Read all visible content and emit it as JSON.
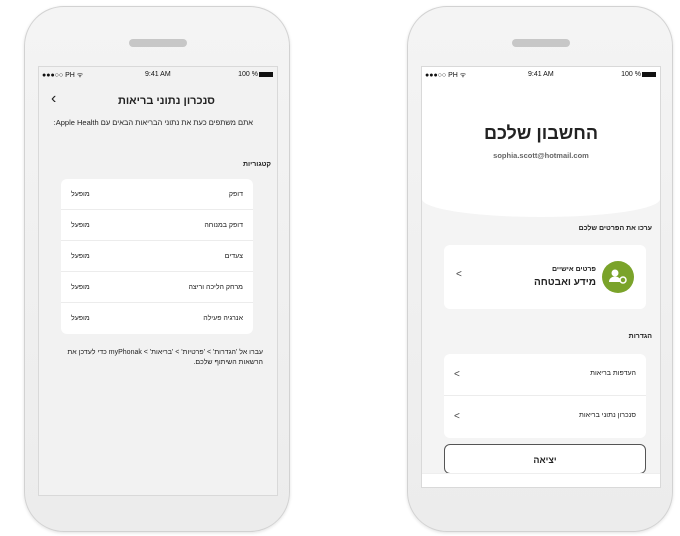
{
  "status": {
    "carrier": "●●●○○ PH ᯤ",
    "time": "9:41 AM",
    "battery": "100 %"
  },
  "left": {
    "title": "סנכרון נתוני בריאות",
    "intro": "אתם משתפים כעת את נתוני הבריאות הבאים עם Apple Health:",
    "section": "קטגוריות",
    "rows": [
      {
        "name": "דופק",
        "state": "מופעל"
      },
      {
        "name": "דופק במנוחה",
        "state": "מופעל"
      },
      {
        "name": "צעדים",
        "state": "מופעל"
      },
      {
        "name": "מרחק הליכה וריצה",
        "state": "מופעל"
      },
      {
        "name": "אנרגיה פעילה",
        "state": "מופעל"
      }
    ],
    "note": "עברו אל 'הגדרות' > 'פרטיות' > 'בריאות' > myPhonak כדי לעדכן את הרשאות השיתוף שלכם."
  },
  "right": {
    "title": "החשבון שלכם",
    "email": "sophia.scott@hotmail.com",
    "edit_section": "ערכו את הפרטים שלכם",
    "personal_sub": "פרטים אישיים",
    "personal_main": "מידע ואבטחה",
    "settings_section": "הגדרות",
    "settings": [
      "העדפות בריאות",
      "סנכרון נתוני בריאות"
    ],
    "logout": "יציאה"
  }
}
